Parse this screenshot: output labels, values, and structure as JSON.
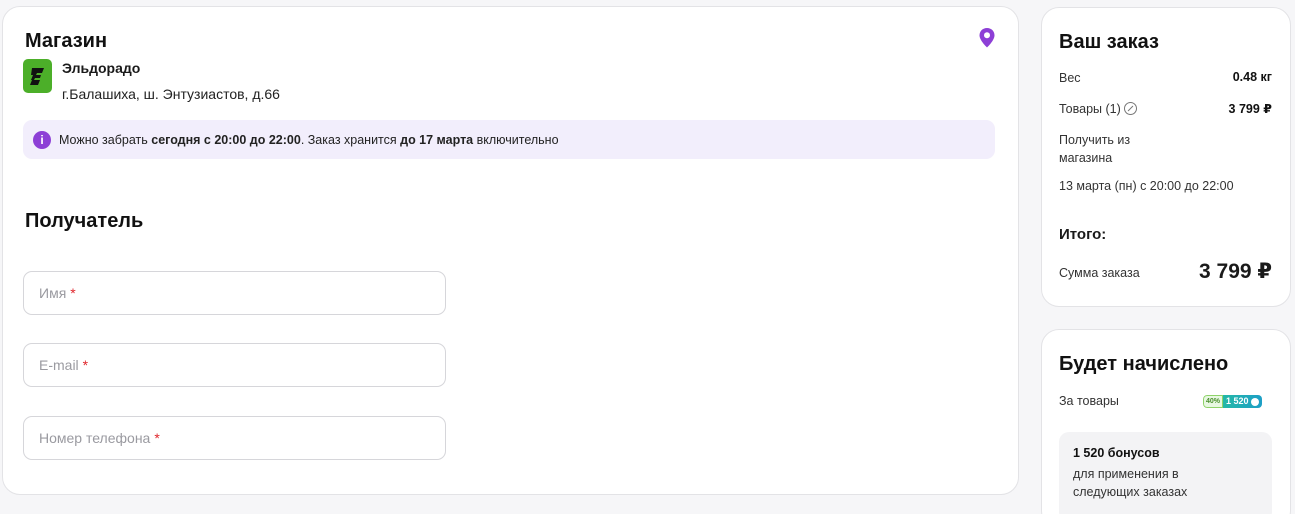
{
  "store": {
    "title": "Магазин",
    "name": "Эльдорадо",
    "address": "г.Балашиха, ш. Энтузиастов, д.66",
    "logo_letter": "Э"
  },
  "notice": {
    "text_1": "Можно забрать ",
    "bold_1": "сегодня с 20:00 до 22:00",
    "text_2": ". Заказ хранится ",
    "bold_2": "до 17 марта",
    "text_3": " включительно"
  },
  "recipient": {
    "title": "Получатель",
    "fields": [
      {
        "placeholder": "Имя",
        "required_mark": "*"
      },
      {
        "placeholder": "E-mail",
        "required_mark": "*"
      },
      {
        "placeholder": "Номер телефона",
        "required_mark": "*"
      }
    ]
  },
  "order": {
    "title": "Ваш заказ",
    "weight_label": "Вес",
    "weight_value": "0.48 кг",
    "items_label": "Товары (1)",
    "items_value": "3 799 ₽",
    "pickup_line1": "Получить из",
    "pickup_line2": "магазина",
    "pickup_date": "13 марта (пн)  с 20:00 до 22:00",
    "total_label": "Итого:",
    "sum_label": "Сумма заказа",
    "sum_value": "3 799 ₽"
  },
  "bonus": {
    "title": "Будет начислено",
    "for_items_label": "За товары",
    "badge_percent": "40%",
    "badge_amount": "1 520",
    "box_count": "1 520 бонусов",
    "box_desc_line1": "для применения в",
    "box_desc_line2": "следующих заказах"
  },
  "colors": {
    "accent": "#8d3fd6",
    "store_green": "#4caf29",
    "required": "#e0262c",
    "notice_bg": "#f2eefc"
  }
}
